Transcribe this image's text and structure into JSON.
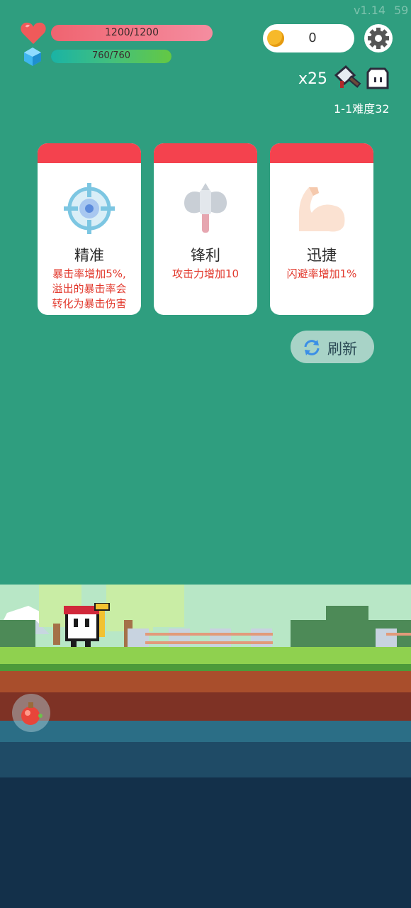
{
  "version": "v1.14",
  "fps": "59",
  "hp": {
    "text": "1200/1200",
    "fill": 1.0
  },
  "mp": {
    "text": "760/760",
    "fill": 1.0
  },
  "coins": "0",
  "multiplier": "x25",
  "stage": "1-1难度32",
  "cards": [
    {
      "name": "精准",
      "desc_lines": [
        "暴击率增加5%,",
        "溢出的暴击率会",
        "转化为暴击伤害"
      ],
      "icon": "target-icon"
    },
    {
      "name": "锋利",
      "desc_lines": [
        "攻击力增加10"
      ],
      "icon": "axe-icon"
    },
    {
      "name": "迅捷",
      "desc_lines": [
        "闪避率增加1%"
      ],
      "icon": "muscle-arm-icon"
    }
  ],
  "refresh_label": "刷新",
  "colors": {
    "background": "#2f9e7f",
    "card_cap": "#f4424e",
    "desc_red": "#e23a2e",
    "hp_bar": "#f27382",
    "mp_bar": "#3cc088"
  }
}
